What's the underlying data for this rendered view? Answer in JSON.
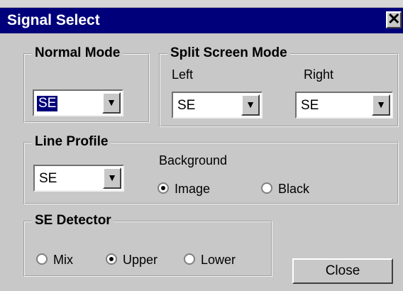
{
  "window": {
    "title": "Signal Select",
    "close_glyph": "✕"
  },
  "normal_mode": {
    "legend": "Normal Mode",
    "value": "SE"
  },
  "split_screen_mode": {
    "legend": "Split Screen Mode",
    "left_label": "Left",
    "left_value": "SE",
    "right_label": "Right",
    "right_value": "SE"
  },
  "line_profile": {
    "legend": "Line Profile",
    "value": "SE",
    "background_label": "Background",
    "options": [
      {
        "label": "Image",
        "selected": true
      },
      {
        "label": "Black",
        "selected": false
      }
    ]
  },
  "se_detector": {
    "legend": "SE Detector",
    "options": [
      {
        "label": "Mix",
        "selected": false
      },
      {
        "label": "Upper",
        "selected": true
      },
      {
        "label": "Lower",
        "selected": false
      }
    ]
  },
  "buttons": {
    "close_label": "Close"
  },
  "icons": {
    "dropdown_arrow": "chevron-down-icon",
    "close": "close-icon"
  },
  "colors": {
    "titlebar": "#00007a",
    "face": "#c8c8c8",
    "selection": "#00007a"
  }
}
